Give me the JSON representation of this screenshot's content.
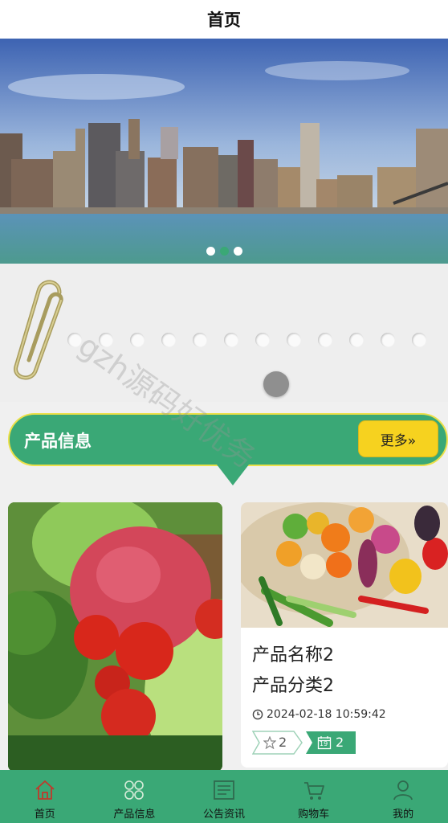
{
  "header": {
    "title": "首页"
  },
  "banner": {
    "slide_count": 3,
    "active_index": 1
  },
  "section": {
    "title": "产品信息",
    "more_label": "更多»"
  },
  "products": [
    {
      "name": "产品名称2",
      "category": "产品分类2",
      "time": "2024-02-18 10:59:42",
      "likes": "2",
      "calendar_icon_label": "19",
      "calendar_count": "2"
    }
  ],
  "watermark": "gzh源码好优务",
  "tabbar": {
    "items": [
      {
        "label": "首页",
        "icon": "home-icon",
        "active": true
      },
      {
        "label": "产品信息",
        "icon": "grid-icon",
        "active": false
      },
      {
        "label": "公告资讯",
        "icon": "news-icon",
        "active": false
      },
      {
        "label": "购物车",
        "icon": "cart-icon",
        "active": false
      },
      {
        "label": "我的",
        "icon": "user-icon",
        "active": false
      }
    ]
  },
  "colors": {
    "primary": "#3aa876",
    "accent_yellow": "#f6d21f",
    "border_yellow": "#ece049",
    "active_tab": "#c0392b"
  }
}
